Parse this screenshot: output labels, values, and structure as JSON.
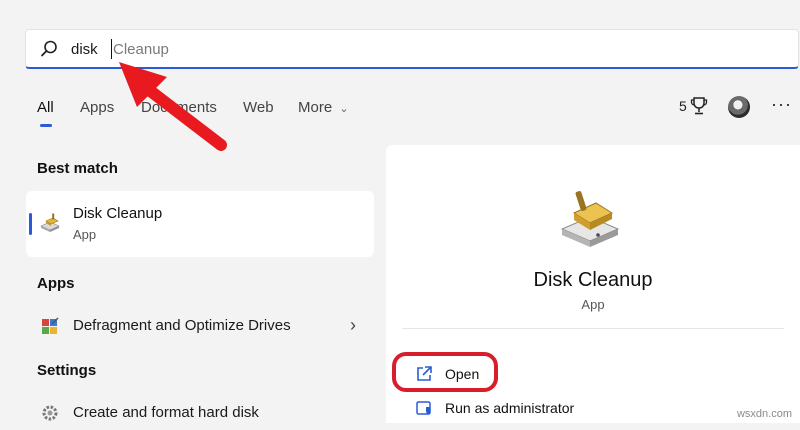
{
  "search": {
    "typed": "disk",
    "suggestion": "Cleanup"
  },
  "tabs": [
    {
      "label": "All",
      "active": true
    },
    {
      "label": "Apps"
    },
    {
      "label": "Documents"
    },
    {
      "label": "Web"
    },
    {
      "label": "More"
    }
  ],
  "header_right": {
    "rewards_count": "5",
    "more_label": "···"
  },
  "best_match": {
    "heading": "Best match",
    "title": "Disk Cleanup",
    "subtitle": "App",
    "icon": "disk-cleanup-icon"
  },
  "apps": {
    "heading": "Apps",
    "items": [
      {
        "label": "Defragment and Optimize Drives",
        "icon": "defragment-icon"
      }
    ]
  },
  "settings": {
    "heading": "Settings",
    "items": [
      {
        "label": "Create and format hard disk",
        "icon": "settings-gear-icon"
      }
    ]
  },
  "detail": {
    "title": "Disk Cleanup",
    "subtitle": "App",
    "actions": [
      {
        "label": "Open",
        "icon": "open-external-icon"
      },
      {
        "label": "Run as administrator",
        "icon": "admin-shield-icon"
      }
    ]
  },
  "annotation": {
    "highlight_color": "#d81e2a",
    "arrow_color": "#e8191f"
  },
  "watermark": "wsxdn.com",
  "colors": {
    "accent": "#2a5bd7",
    "background": "#f3f3f3",
    "card": "#ffffff"
  }
}
